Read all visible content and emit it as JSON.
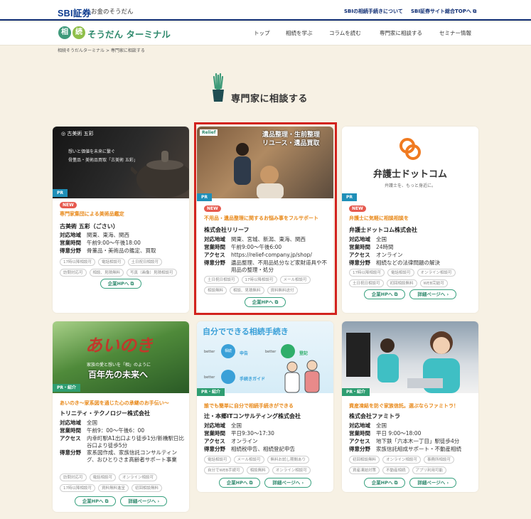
{
  "topbar": {
    "brand": "SBI証券",
    "brand_sub": "お金のそうだん",
    "link1": "SBIの相続手続きについて",
    "link2": "SBI証券サイト総合TOPへ"
  },
  "header": {
    "logo_c1": "相",
    "logo_c2": "続",
    "logo_text": "そうだん ターミナル",
    "nav": [
      "トップ",
      "相続を学ぶ",
      "コラムを読む",
      "専門家に相談する",
      "セミナー情報"
    ]
  },
  "breadcrumb": {
    "home": "相続そうだんターミナル",
    "sep": ">",
    "current": "専門家に相談する"
  },
  "page_title": "専門家に相談する",
  "labels": {
    "area": "対応地域",
    "hours": "営業時間",
    "access": "アクセス",
    "field": "得意分野",
    "hp": "企業HPへ",
    "detail": "詳細ページへ"
  },
  "cards": [
    {
      "badge": "PR",
      "new": "NEW",
      "thumb_logo": "古美術 五彩",
      "thumb_line1": "想いと価値を未来に繋ぐ",
      "thumb_line2": "骨董品・美術品買取「古美術 五彩」",
      "title": "専門家集団による美術品鑑定",
      "company": "古美術 五彩（ごさい）",
      "area": "関東、東海、関西",
      "hours": "午前9:00〜午後18:00",
      "field": "骨董品・美術品の鑑定、買取",
      "tags": [
        "17時以降相談可",
        "電話相談可",
        "土日祝日相談可",
        "訪問対応可",
        "相談、見積無料",
        "写真（画像）見積相談可"
      ]
    },
    {
      "badge": "PR",
      "new": "NEW",
      "thumb_logo": "Relief",
      "thumb_line1": "遺品整理・生前整理",
      "thumb_line2": "リユース・遺品買取",
      "title": "不用品・遺品整理に関するお悩み事をフルサポート",
      "company": "株式会社リリーフ",
      "area": "関東、宮城、新潟、東海、関西",
      "hours": "午前9:00〜午後6:00",
      "access": "https://relief-company.jp/shop/",
      "field": "遺品整理、不用品処分など家財道具や不用品の整理・処分",
      "tags": [
        "土日祝日相談可",
        "17時以降相談可",
        "メール相談可",
        "相談無料",
        "相談、見積無料",
        "資料無料送付"
      ]
    },
    {
      "badge": "PR",
      "new": "NEW",
      "thumb_logo": "弁護士ドットコム",
      "thumb_line1": "弁護士を、もっと身近に。",
      "title": "弁護士に気軽に相談相談を",
      "company": "弁護士ドットコム株式会社",
      "area": "全国",
      "hours": "24時間",
      "access": "オンライン",
      "field": "相続などの法律問題の解決",
      "tags": [
        "17時以降相談可",
        "電話相談可",
        "オンライン相談可",
        "土日祝日相談可",
        "初回相談無料",
        "WEB完結可"
      ]
    },
    {
      "badge": "PR・紹介",
      "thumb_logo": "あいのき",
      "thumb_line1": "家族の愛と想いを「相」のように",
      "thumb_line2": "百年先の未来へ",
      "title": "あいのき〜家系図を通じた心の承継のお手伝い〜",
      "company": "トリニティ・テクノロジー株式会社",
      "area": "全国",
      "hours": "午前9：00〜午後6：00",
      "access": "内幸町駅A1出口より徒歩1分/新橋駅日比谷口より徒歩5分",
      "field": "家系図作成、家族信託コンサルティング、おひとりさま高齢者サポート事業",
      "tags": [
        "訪問対応可",
        "電話相談可",
        "オンライン相談可",
        "17時以降相談可",
        "資料無料進呈",
        "初回相談無料"
      ]
    },
    {
      "badge": "PR・紹介",
      "thumb_logo": "自分でできる相続手続き",
      "thumb_items": [
        "相続",
        "申告",
        "登記",
        "手続きガイド"
      ],
      "thumb_brand": "better",
      "title": "誰でも簡単に自分で相続手続きができる",
      "company": "辻・本郷ITコンサルティング株式会社",
      "area": "全国",
      "hours": "平日9:30〜17:30",
      "access": "オンライン",
      "field": "相続税申告、相続登記申告",
      "tags": [
        "電話相談可",
        "メール相談可",
        "無料お試し期間あり",
        "自分でWEB手続可",
        "相談無料",
        "オンライン相談可"
      ]
    },
    {
      "badge": "PR・紹介",
      "title": "資産凍結を防ぐ家族信託。選ぶならファミトラ！",
      "company": "株式会社ファミトラ",
      "area": "全国",
      "hours": "平日 9:00〜18:00",
      "access": "地下鉄「六本木一丁目」駅徒歩4分",
      "field": "家族信託組成サポート・不動産相続",
      "tags": [
        "初回相談無料",
        "オンライン相談可",
        "事務所相談可",
        "資産凍結対策",
        "不動産相続",
        "アプリ利用可能"
      ]
    }
  ]
}
